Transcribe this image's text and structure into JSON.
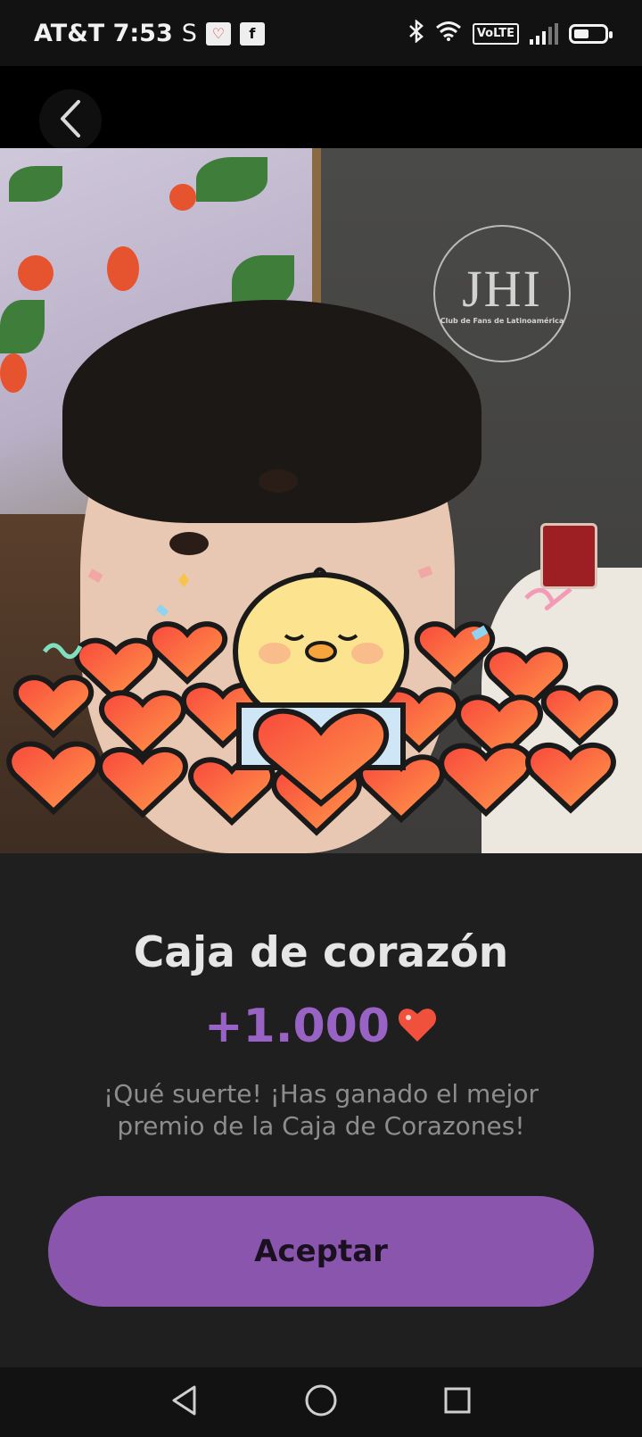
{
  "status_bar": {
    "carrier_time": "AT&T 7:53",
    "s_label": "S",
    "volte_label": "VoLTE"
  },
  "photo": {
    "watermark_sub": "Club de Fans de Latinoamérica"
  },
  "reward": {
    "title": "Caja de corazón",
    "amount": "+1.000",
    "message": "¡Qué suerte! ¡Has ganado el mejor premio de la Caja de Corazones!"
  },
  "actions": {
    "accept_label": "Aceptar"
  },
  "colors": {
    "accent": "#8a56ad",
    "amount": "#9863c4",
    "heart": "#f0513d"
  },
  "icons": {
    "back": "back-chevron-icon",
    "nav_back": "triangle-back-icon",
    "nav_home": "circle-home-icon",
    "nav_recents": "square-recents-icon"
  }
}
